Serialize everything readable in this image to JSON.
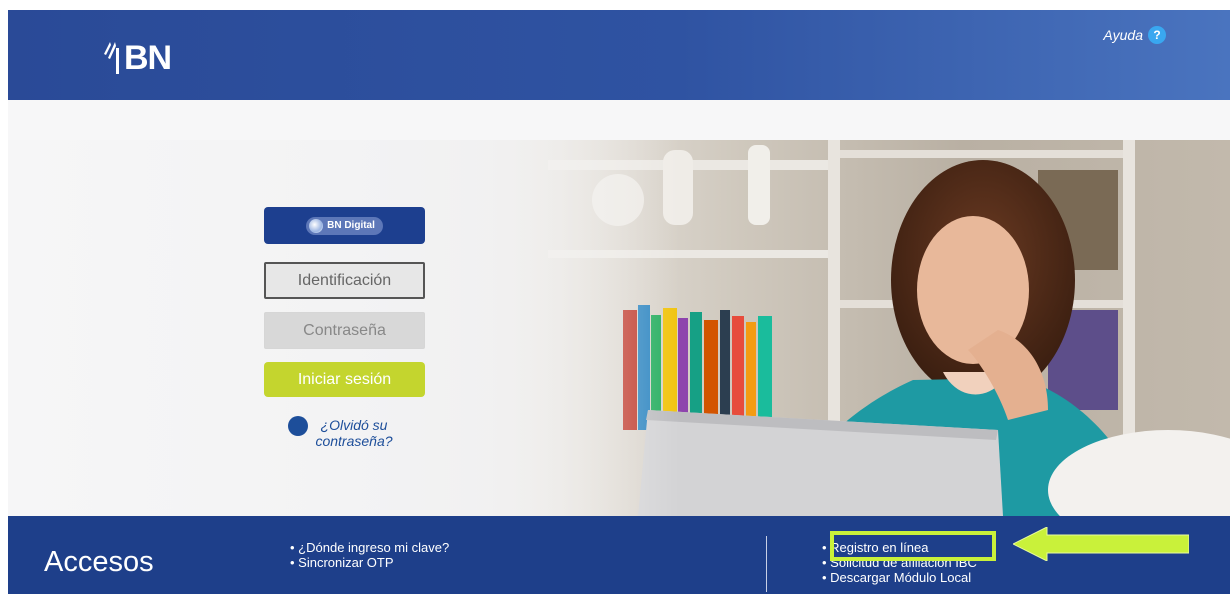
{
  "brand": {
    "name": "BN",
    "help_label": "Ayuda",
    "help_icon": "question-icon"
  },
  "login": {
    "brand_button_label": "BN Digital",
    "id_placeholder": "Identificación",
    "password_placeholder": "Contraseña",
    "signin_label": "Iniciar sesión",
    "forgot_label": "¿Olvidó su contraseña?"
  },
  "footer": {
    "title": "Accesos",
    "left_links": [
      "¿Dónde ingreso mi clave?",
      "Sincronizar OTP"
    ],
    "right_links": [
      "Registro en línea",
      "Solicitud de afiliación IBC",
      "Descargar Módulo Local"
    ]
  },
  "colors": {
    "header_blue": "#2a4a97",
    "footer_blue": "#1e3f8a",
    "signin_green": "#c4d52e",
    "highlight_green": "#c9f13a"
  }
}
